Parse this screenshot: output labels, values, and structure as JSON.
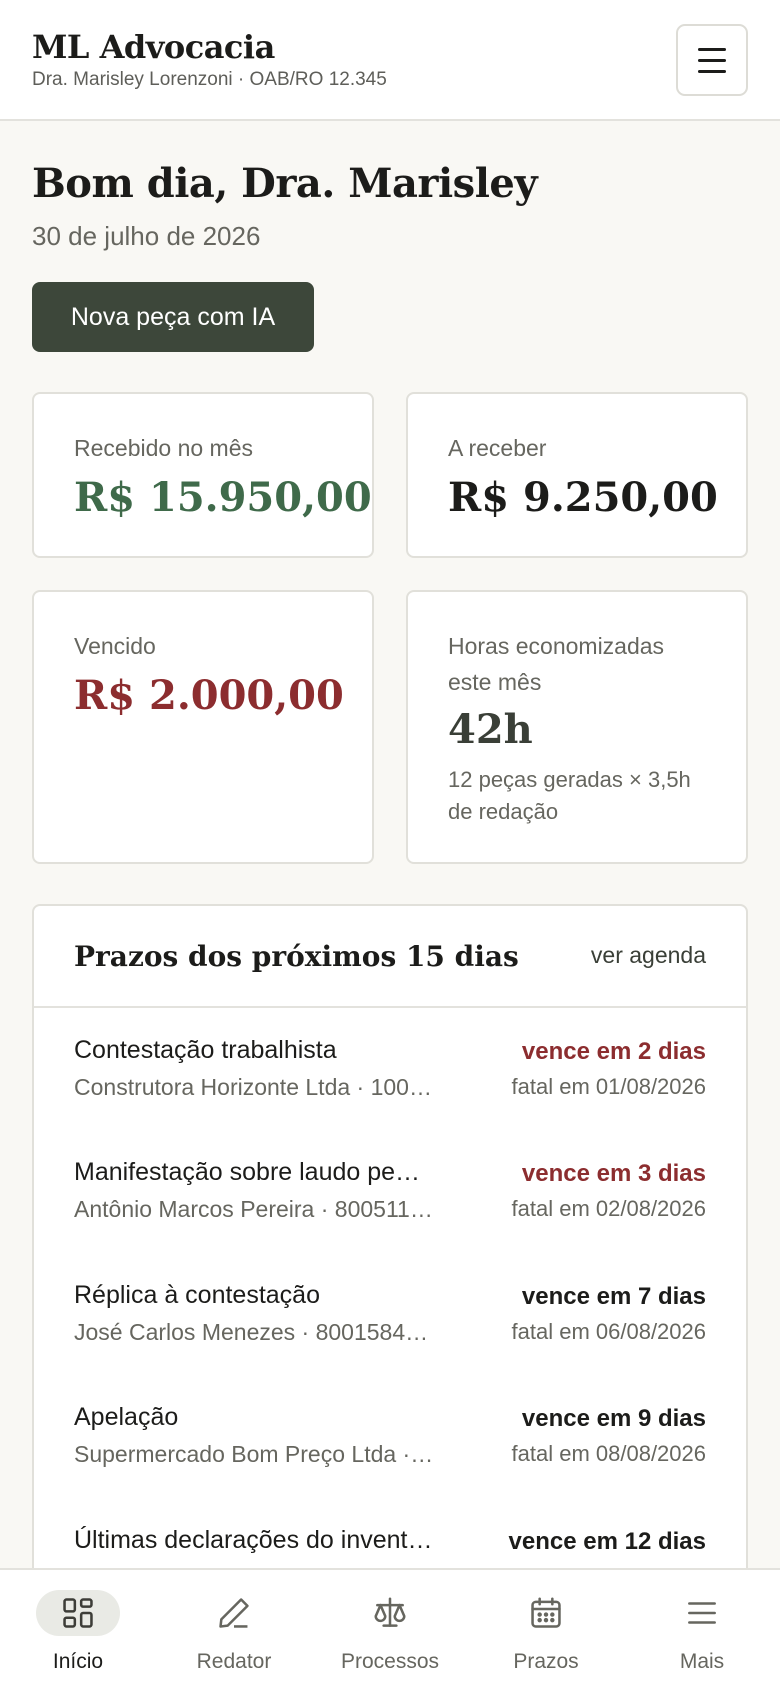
{
  "header": {
    "title": "ML Advocacia",
    "subtitle": "Dra. Marisley Lorenzoni · OAB/RO 12.345",
    "menu_icon": "hamburger-menu-icon"
  },
  "greeting": {
    "title": "Bom dia, Dra. Marisley",
    "date": "30 de julho de 2026",
    "cta_label": "Nova peça com IA"
  },
  "stats": {
    "received": {
      "label": "Recebido no mês",
      "value": "R$ 15.950,00",
      "color": "#3f6a4a"
    },
    "receivable": {
      "label": "A receber",
      "value": "R$ 9.250,00",
      "color": "#1c1c1a"
    },
    "overdue": {
      "label": "Vencido",
      "value": "R$ 2.000,00",
      "color": "#8c2d2f"
    },
    "hours_saved": {
      "label": "Horas economizadas este mês",
      "value": "42h",
      "note": "12 peças geradas × 3,5h de redação"
    }
  },
  "deadlines": {
    "title": "Prazos dos próximos 15 dias",
    "link_label": "ver agenda",
    "items": [
      {
        "title": "Contestação trabalhista",
        "subtitle": "Construtora Horizonte Ltda · 100…",
        "due": "vence em 2 dias",
        "fatal": "fatal em 01/08/2026",
        "urgent": true
      },
      {
        "title": "Manifestação sobre laudo pe…",
        "subtitle": "Antônio Marcos Pereira · 800511…",
        "due": "vence em 3 dias",
        "fatal": "fatal em 02/08/2026",
        "urgent": true
      },
      {
        "title": "Réplica à contestação",
        "subtitle": "José Carlos Menezes · 8001584…",
        "due": "vence em 7 dias",
        "fatal": "fatal em 06/08/2026",
        "urgent": false
      },
      {
        "title": "Apelação",
        "subtitle": "Supermercado Bom Preço Ltda ·…",
        "due": "vence em 9 dias",
        "fatal": "fatal em 08/08/2026",
        "urgent": false
      },
      {
        "title": "Últimas declarações do invent…",
        "subtitle": "",
        "due": "vence em 12 dias",
        "fatal": "",
        "urgent": false
      }
    ]
  },
  "bottom_nav": {
    "items": [
      {
        "label": "Início",
        "icon": "grid-icon",
        "active": true
      },
      {
        "label": "Redator",
        "icon": "pencil-icon",
        "active": false
      },
      {
        "label": "Processos",
        "icon": "scales-icon",
        "active": false
      },
      {
        "label": "Prazos",
        "icon": "calendar-icon",
        "active": false
      },
      {
        "label": "Mais",
        "icon": "menu-icon",
        "active": false
      }
    ]
  },
  "colors": {
    "accent": "#3d473a",
    "positive": "#3f6a4a",
    "negative": "#8c2d2f",
    "background": "#f9f8f4"
  }
}
